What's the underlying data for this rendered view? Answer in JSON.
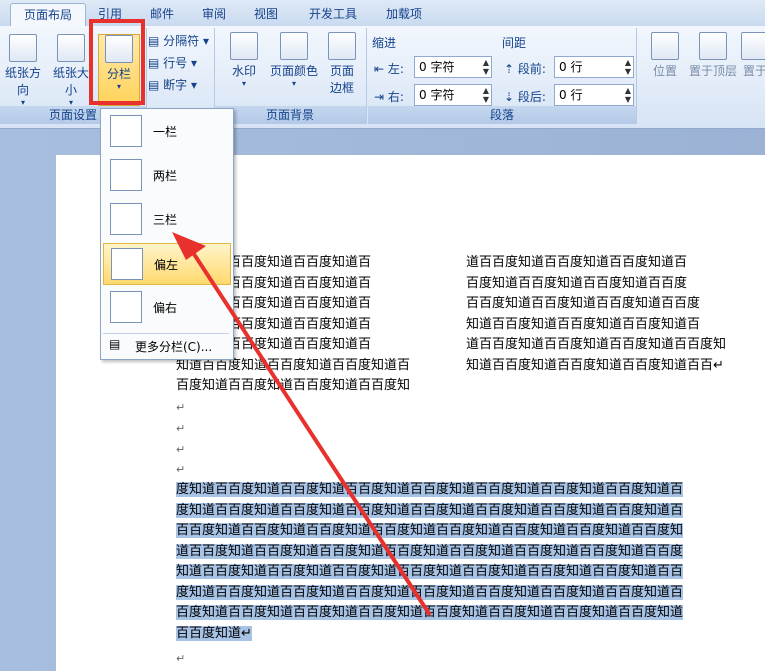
{
  "tabs": [
    "页面布局",
    "引用",
    "邮件",
    "审阅",
    "视图",
    "开发工具",
    "加载项"
  ],
  "ribbon": {
    "page_setup": {
      "label": "页面设置",
      "paper_direction": "纸张方向",
      "paper_size": "纸张大小",
      "columns": "分栏",
      "separator": "分隔符",
      "line_numbers": "行号",
      "hyphenation": "断字"
    },
    "page_background": {
      "label": "页面背景",
      "watermark": "水印",
      "page_color": "页面颜色",
      "page_border_1": "页面",
      "page_border_2": "边框"
    },
    "paragraph": {
      "label": "段落",
      "indent_title": "缩进",
      "spacing_title": "间距",
      "left": "左:",
      "right": "右:",
      "before": "段前:",
      "after": "段后:",
      "left_value": "0 字符",
      "right_value": "0 字符",
      "before_value": "0 行",
      "after_value": "0 行"
    },
    "arrange": {
      "position": "位置",
      "bring_front": "置于顶层",
      "send_back": "置于"
    }
  },
  "menu": {
    "items": [
      "一栏",
      "两栏",
      "三栏",
      "偏左",
      "偏右"
    ],
    "more": "更多分栏(C)..."
  },
  "document": {
    "left_col": [
      "百度知道百百度知道百百度知道百",
      "百度知道百百度知道百百度知道百",
      "百度知道百百度知道百百度知道百",
      "百度知道百百度知道百百度知道百",
      "百度知道百百度知道百百度知道百",
      "知道百百度知道百百度知道百百度知道百",
      "百度知道百百度知道百百度知道百百度知"
    ],
    "right_col": [
      "道百百度知道百百度知道百百度知道百",
      "百度知道百百度知道百百度知道百百度",
      "百百度知道百百度知道百百度知道百百度",
      "知道百百度知道百百度知道百百度知道百",
      "道百百度知道百百度知道百百度知道百百度知",
      "知道百百度知道百百度知道百百度知道百百↵"
    ],
    "selected_lines": [
      "度知道百百度知道百百度知道百百度知道百百度知道百百度知道百百度知道百百度知道百",
      "度知道百百度知道百百度知道百百度知道百百度知道百百度知道百百度知道百百度知道百",
      "百百度知道百百度知道百百度知道百百度知道百百度知道百百度知道百百度知道百百度知",
      "道百百度知道百百度知道百百度知道百百度知道百百度知道百百度知道百百度知道百百度",
      "知道百百度知道百百度知道百百度知道百百度知道百百度知道百百度知道百百度知道百百",
      "度知道百百度知道百百度知道百百度知道百百度知道百百度知道百百度知道百百度知道百",
      "百度知道百百度知道百百度知道百百度知道百百度知道百百度知道百百度知道百百度知道",
      "百百度知道↵"
    ],
    "para_mark": "↵"
  },
  "colors": {
    "highlight": "#e8312d",
    "accent": "#15428b"
  }
}
